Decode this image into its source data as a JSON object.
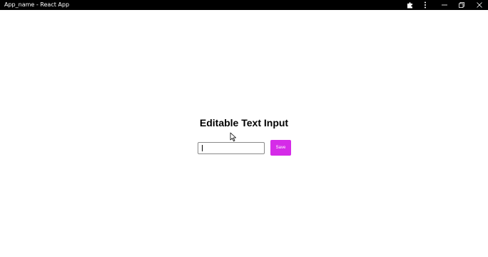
{
  "window": {
    "title": "App_name - React App",
    "controls": {
      "extensions_icon": "puzzle-icon",
      "menu_icon": "kebab-menu-icon",
      "minimize_icon": "minimize-icon",
      "maximize_icon": "restore-icon",
      "close_icon": "close-icon"
    }
  },
  "main": {
    "heading": "Editable Text Input",
    "input": {
      "value": "",
      "placeholder": ""
    },
    "save_label": "Save"
  },
  "colors": {
    "titlebar_bg": "#000000",
    "save_button_bg": "#d52be8",
    "save_button_text": "#ffffff",
    "input_border": "#8a8a8a"
  }
}
